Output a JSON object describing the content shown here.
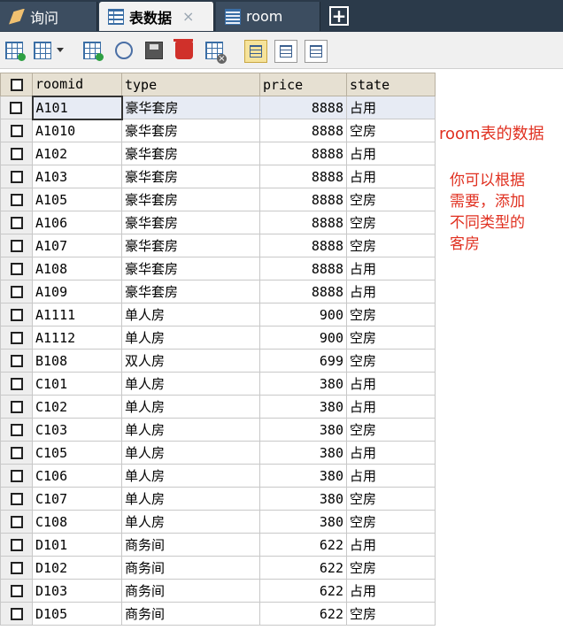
{
  "tabs": [
    {
      "label": "询问",
      "icon": "query-icon"
    },
    {
      "label": "表数据",
      "icon": "table-icon",
      "close": "×"
    },
    {
      "label": "room",
      "icon": "room-table-icon"
    }
  ],
  "add_tab_symbol": "+",
  "grid": {
    "columns": [
      "roomid",
      "type",
      "price",
      "state"
    ],
    "rows": [
      [
        "A101",
        "豪华套房",
        "8888",
        "占用"
      ],
      [
        "A1010",
        "豪华套房",
        "8888",
        "空房"
      ],
      [
        "A102",
        "豪华套房",
        "8888",
        "占用"
      ],
      [
        "A103",
        "豪华套房",
        "8888",
        "占用"
      ],
      [
        "A105",
        "豪华套房",
        "8888",
        "空房"
      ],
      [
        "A106",
        "豪华套房",
        "8888",
        "空房"
      ],
      [
        "A107",
        "豪华套房",
        "8888",
        "空房"
      ],
      [
        "A108",
        "豪华套房",
        "8888",
        "占用"
      ],
      [
        "A109",
        "豪华套房",
        "8888",
        "占用"
      ],
      [
        "A1111",
        "单人房",
        "900",
        "空房"
      ],
      [
        "A1112",
        "单人房",
        "900",
        "空房"
      ],
      [
        "B108",
        "双人房",
        "699",
        "空房"
      ],
      [
        "C101",
        "单人房",
        "380",
        "占用"
      ],
      [
        "C102",
        "单人房",
        "380",
        "占用"
      ],
      [
        "C103",
        "单人房",
        "380",
        "空房"
      ],
      [
        "C105",
        "单人房",
        "380",
        "占用"
      ],
      [
        "C106",
        "单人房",
        "380",
        "占用"
      ],
      [
        "C107",
        "单人房",
        "380",
        "空房"
      ],
      [
        "C108",
        "单人房",
        "380",
        "空房"
      ],
      [
        "D101",
        "商务间",
        "622",
        "占用"
      ],
      [
        "D102",
        "商务间",
        "622",
        "空房"
      ],
      [
        "D103",
        "商务间",
        "622",
        "占用"
      ],
      [
        "D105",
        "商务间",
        "622",
        "空房"
      ]
    ]
  },
  "annotation": {
    "title": "room表的数据",
    "lines": [
      "你可以根据",
      "需要，添加",
      "不同类型的",
      "客房"
    ],
    "color": "#e03020"
  }
}
